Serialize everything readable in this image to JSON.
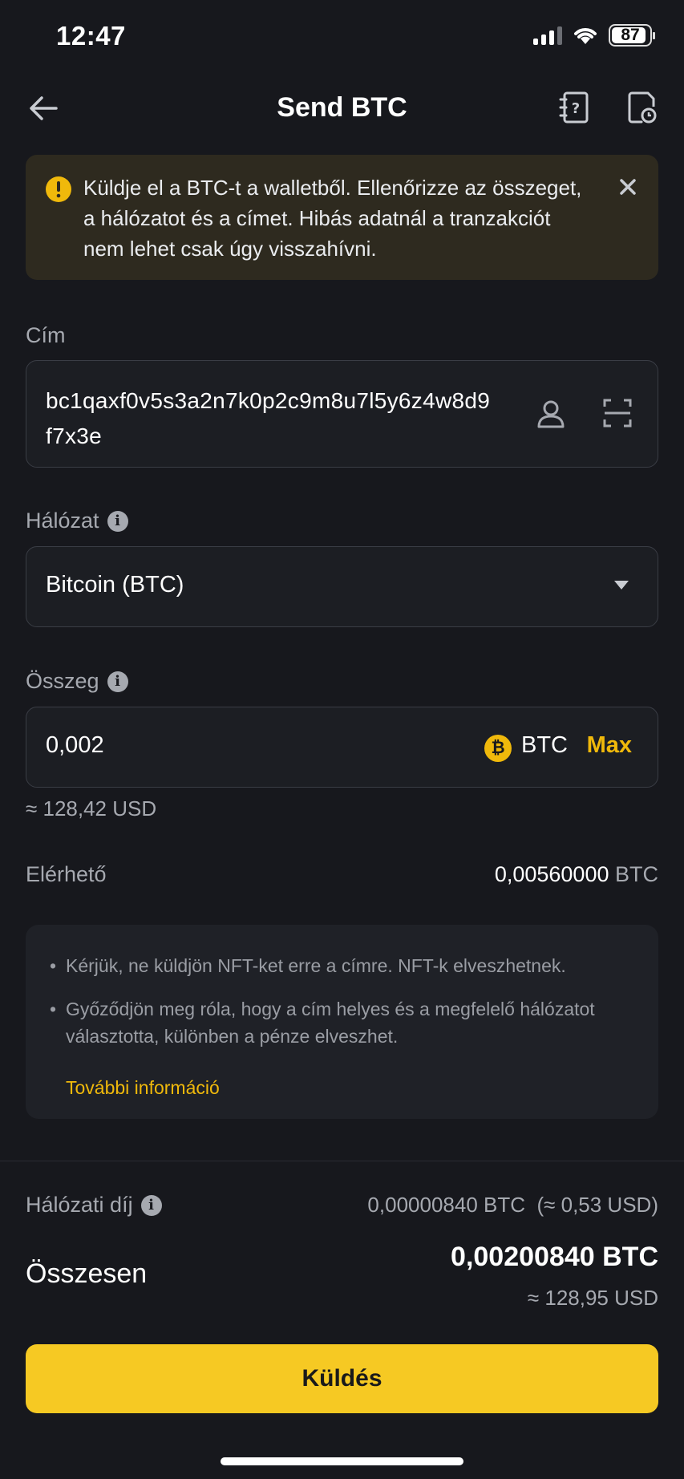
{
  "status": {
    "time": "12:47",
    "battery": "87"
  },
  "header": {
    "title": "Send BTC"
  },
  "warning": {
    "text": "Küldje el a BTC-t a walletből. Ellenőrizze az összeget, a hálózatot és a címet. Hibás adatnál a tranzakciót nem lehet csak úgy visszahívni."
  },
  "address": {
    "label": "Cím",
    "value": "bc1qaxf0v5s3a2n7k0p2c9m8u7l5y6z4w8d9f7x3e"
  },
  "network": {
    "label": "Hálózat",
    "value": "Bitcoin (BTC)"
  },
  "amount": {
    "label": "Összeg",
    "value": "0,002",
    "unit": "BTC",
    "max_label": "Max",
    "approx": "≈ 128,42 USD"
  },
  "available": {
    "label": "Elérhető",
    "value": "0,00560000",
    "unit": "BTC"
  },
  "notice": {
    "items": [
      "Kérjük, ne küldjön NFT-ket erre a címre. NFT-k elveszhetnek.",
      "Győződjön meg róla, hogy a cím helyes és a megfelelő hálózatot választotta, különben a pénze elveszhet."
    ],
    "more_label": "További információ"
  },
  "fee": {
    "label": "Hálózati díj",
    "value": "0,00000840 BTC  (≈ 0,53 USD)"
  },
  "total": {
    "label": "Összesen",
    "value": "0,00200840 BTC",
    "approx": "≈ 128,95 USD"
  },
  "send_button": {
    "label": "Küldés"
  },
  "colors": {
    "accent": "#f0b90b",
    "background": "#17181d",
    "warning_bg": "#2e2a1f"
  },
  "icons": [
    "back-arrow-icon",
    "help-book-icon",
    "history-icon",
    "warning-icon",
    "close-icon",
    "contact-icon",
    "scan-icon",
    "info-icon",
    "chevron-down-icon",
    "bitcoin-icon"
  ]
}
